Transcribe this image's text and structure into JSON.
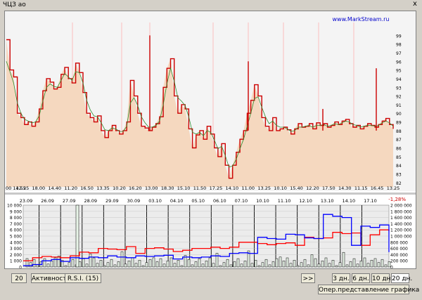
{
  "window": {
    "title": "ЧЦЗ ао",
    "close_label": "x"
  },
  "watermark": "www.MarkStream.ru",
  "chart_data": [
    {
      "type": "area",
      "yticks": [
        "99",
        "98",
        "97",
        "96",
        "95",
        "94",
        "93",
        "92",
        "91",
        "90",
        "89",
        "88",
        "87",
        "86",
        "85",
        "84",
        "83",
        "82"
      ],
      "xticks": [
        "00 14.55",
        "12.25",
        "18.00",
        "14.40",
        "11.20",
        "16.50",
        "13.35",
        "10.20",
        "16.20",
        "13.00",
        "18.30",
        "15.10",
        "11.50",
        "17.25",
        "14.10",
        "11.00",
        "13.25",
        "10.10",
        "15.40",
        "12.20",
        "17.50",
        "14.30",
        "11.15",
        "16.45",
        "13.25"
      ],
      "ylim": [
        81.5,
        100
      ],
      "series": [
        {
          "values": [
            98.5,
            95,
            94.2,
            90,
            89.5,
            88.7,
            89,
            88.5,
            89,
            90.5,
            92.6,
            94,
            93.6,
            92.8,
            93,
            94.5,
            95.3,
            94,
            93.5,
            95.8,
            94.7,
            92.4,
            90,
            89.5,
            89,
            89.7,
            88,
            87.2,
            88,
            88.6,
            88,
            87.6,
            88,
            89,
            93.8,
            92,
            90,
            88.5,
            88.3,
            88,
            88.4,
            88.8,
            89.6,
            93,
            95.2,
            96.3,
            92,
            90,
            91,
            90.5,
            88.2,
            86,
            87.5,
            88,
            87,
            88.5,
            87.6,
            86,
            85,
            86.5,
            84,
            82.5,
            84,
            85.5,
            87,
            88,
            90,
            91.5,
            93.3,
            92,
            89.5,
            88.5,
            88,
            89.5,
            88,
            88.2,
            88.4,
            88.1,
            87.6,
            88.2,
            88.8,
            88.4,
            88.5,
            88.8,
            88.2,
            88.9,
            88.6,
            88.8,
            88.4,
            88.6,
            89,
            88.7,
            89.1,
            89.3,
            88.8,
            88.4,
            88.6,
            88.2,
            88.5,
            88.8,
            88.6,
            88.4,
            88.7,
            89.1,
            89.4,
            88.7,
            88.2
          ]
        },
        {
          "values": [
            96,
            94.8,
            93.5,
            91.2,
            90,
            89.3,
            89.1,
            88.9,
            89,
            89.7,
            91.4,
            93,
            93.4,
            93.1,
            93,
            93.8,
            94.6,
            94.2,
            93.8,
            94.8,
            94.7,
            93.5,
            91.5,
            90.4,
            89.7,
            89.6,
            88.9,
            88.1,
            88,
            88.3,
            88.2,
            87.9,
            87.9,
            88.5,
            91.2,
            91.8,
            90.9,
            89.6,
            88.9,
            88.4,
            88.4,
            88.6,
            89.1,
            91,
            93.4,
            95.2,
            93.7,
            91.8,
            91.4,
            90.9,
            89.6,
            87.8,
            87.6,
            87.8,
            87.4,
            88,
            87.8,
            86.9,
            85.9,
            86.2,
            85.1,
            83.8,
            83.9,
            84.7,
            85.9,
            87,
            88.5,
            90,
            91.7,
            91.9,
            90.7,
            89.6,
            88.8,
            89.1,
            88.6,
            88.4,
            88.4,
            88.2,
            87.9,
            88,
            88.4,
            88.4,
            88.5,
            88.6,
            88.4,
            88.6,
            88.6,
            88.7,
            88.5,
            88.6,
            88.8,
            88.7,
            88.9,
            89.1,
            89,
            88.7,
            88.6,
            88.4,
            88.5,
            88.6,
            88.6,
            88.5,
            88.6,
            88.9,
            89.1,
            88.9,
            88.5
          ]
        }
      ]
    },
    {
      "type": "line",
      "date_labels": [
        "23.09",
        "26.09",
        "27.09",
        "28.09",
        "29.09",
        "30.09",
        "03.10",
        "04.10",
        "05.10",
        "06.10",
        "07.10",
        "10.10",
        "11.10",
        "12.10",
        "13.10",
        "14.10",
        "17.10"
      ],
      "pct_label": "-1,28%",
      "yticks_left": [
        "10 000",
        "9 000",
        "8 000",
        "7 000",
        "6 000",
        "5 000",
        "4 000",
        "3 000",
        "2 000",
        "1 000",
        "0"
      ],
      "yticks_right": [
        "2 000 000",
        "1 800 000",
        "1 600 000",
        "1 400 000",
        "1 200 000",
        "1 000 000",
        "800 000",
        "600 000",
        "400 000",
        "200 000",
        "0"
      ],
      "series": [
        {
          "color": "#ff0000",
          "values": [
            1000,
            1500,
            1700,
            1600,
            1500,
            1800,
            2400,
            2300,
            3000,
            2900,
            2800,
            3300,
            2200,
            3000,
            3100,
            2900,
            2500,
            2700,
            3000,
            3000,
            3200,
            3000,
            3200,
            4000,
            4000,
            3800,
            3600,
            3800,
            3900,
            3500,
            4800,
            4600,
            4700,
            5600,
            5400,
            5500,
            3500,
            5200,
            6000,
            5800
          ]
        },
        {
          "color": "#0000ff",
          "values": [
            200,
            400,
            1000,
            1200,
            900,
            1500,
            1400,
            1600,
            1500,
            1800,
            1600,
            1500,
            1800,
            1700,
            1800,
            1900,
            1300,
            1600,
            1500,
            1600,
            1800,
            1700,
            2200,
            2300,
            2200,
            4800,
            4600,
            4500,
            5300,
            5200,
            4700,
            4600,
            8500,
            8200,
            8000,
            3500,
            6600,
            6400,
            6800,
            2400
          ]
        }
      ]
    }
  ],
  "bottom_bar": {
    "period_value": "20",
    "activity_label": "Активность",
    "rsi_label": "R.S.I. (15)",
    "scroll_label": ">>",
    "range_3d": "3 дн.",
    "range_6d": "6 дн.",
    "range_10d": "10 дн.",
    "range_20d": "20 дн.",
    "view_label": "Опер.представление графика"
  }
}
